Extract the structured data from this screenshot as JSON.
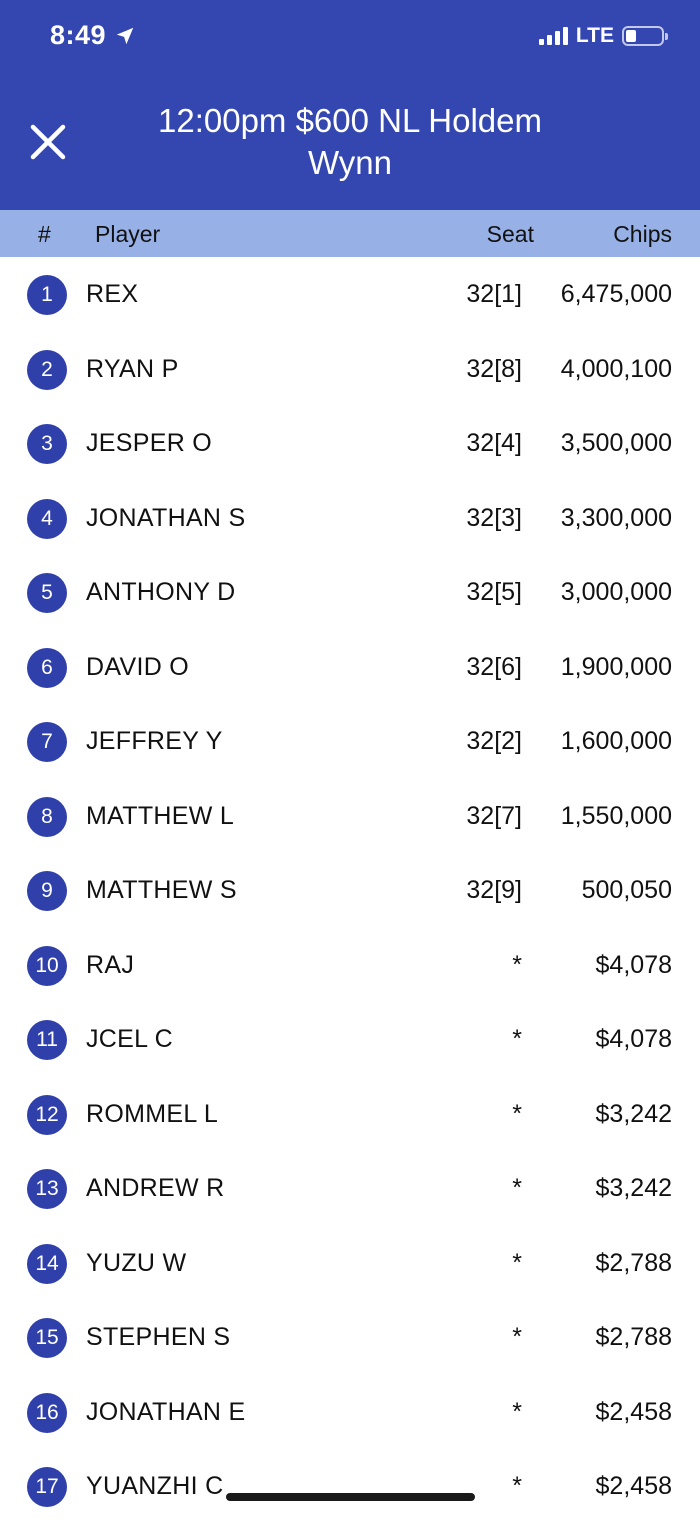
{
  "status_bar": {
    "time": "8:49",
    "network": "LTE",
    "battery_level": 0.3
  },
  "header": {
    "title_line1": "12:00pm $600 NL Holdem",
    "title_line2": "Wynn",
    "close_icon": "close-icon",
    "background": "#3447b0"
  },
  "columns": {
    "num": "#",
    "player": "Player",
    "seat": "Seat",
    "chips": "Chips"
  },
  "rows": [
    {
      "rank": "1",
      "player": "REX",
      "seat": "32[1]",
      "chips": "6,475,000"
    },
    {
      "rank": "2",
      "player": "RYAN P",
      "seat": "32[8]",
      "chips": "4,000,100"
    },
    {
      "rank": "3",
      "player": "JESPER O",
      "seat": "32[4]",
      "chips": "3,500,000"
    },
    {
      "rank": "4",
      "player": "JONATHAN S",
      "seat": "32[3]",
      "chips": "3,300,000"
    },
    {
      "rank": "5",
      "player": "ANTHONY D",
      "seat": "32[5]",
      "chips": "3,000,000"
    },
    {
      "rank": "6",
      "player": "DAVID O",
      "seat": "32[6]",
      "chips": "1,900,000"
    },
    {
      "rank": "7",
      "player": "JEFFREY Y",
      "seat": "32[2]",
      "chips": "1,600,000"
    },
    {
      "rank": "8",
      "player": "MATTHEW L",
      "seat": "32[7]",
      "chips": "1,550,000"
    },
    {
      "rank": "9",
      "player": "MATTHEW S",
      "seat": "32[9]",
      "chips": "500,050"
    },
    {
      "rank": "10",
      "player": "RAJ",
      "seat": "*",
      "chips": "$4,078"
    },
    {
      "rank": "11",
      "player": "JCEL C",
      "seat": "*",
      "chips": "$4,078"
    },
    {
      "rank": "12",
      "player": "ROMMEL L",
      "seat": "*",
      "chips": "$3,242"
    },
    {
      "rank": "13",
      "player": "ANDREW R",
      "seat": "*",
      "chips": "$3,242"
    },
    {
      "rank": "14",
      "player": "YUZU W",
      "seat": "*",
      "chips": "$2,788"
    },
    {
      "rank": "15",
      "player": "STEPHEN S",
      "seat": "*",
      "chips": "$2,788"
    },
    {
      "rank": "16",
      "player": "JONATHAN E",
      "seat": "*",
      "chips": "$2,458"
    },
    {
      "rank": "17",
      "player": "YUANZHI C",
      "seat": "*",
      "chips": "$2,458"
    }
  ]
}
